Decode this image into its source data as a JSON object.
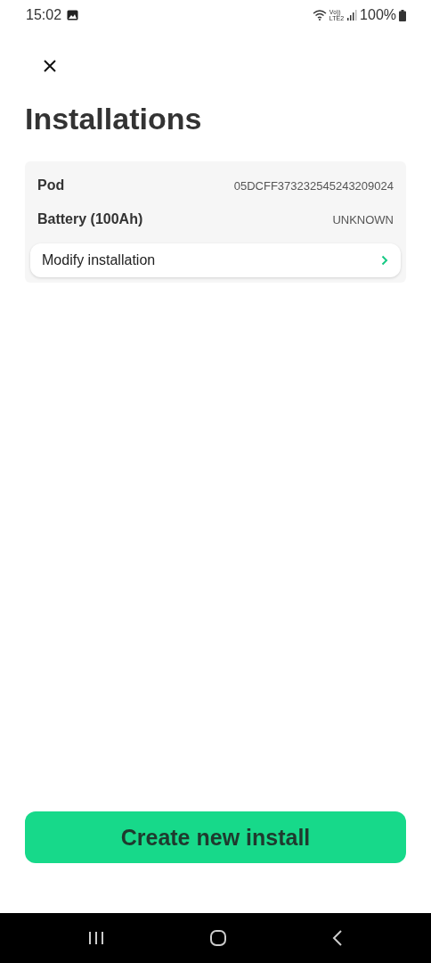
{
  "status_bar": {
    "time": "15:02",
    "network_top": "Vo))",
    "network_bottom": "LTE2",
    "battery": "100%"
  },
  "title": "Installations",
  "installation": {
    "rows": [
      {
        "label": "Pod",
        "value": "05DCFF373232545243209024"
      },
      {
        "label": "Battery (100Ah)",
        "value": "UNKNOWN"
      }
    ],
    "action": "Modify installation"
  },
  "primary_button": "Create new install"
}
